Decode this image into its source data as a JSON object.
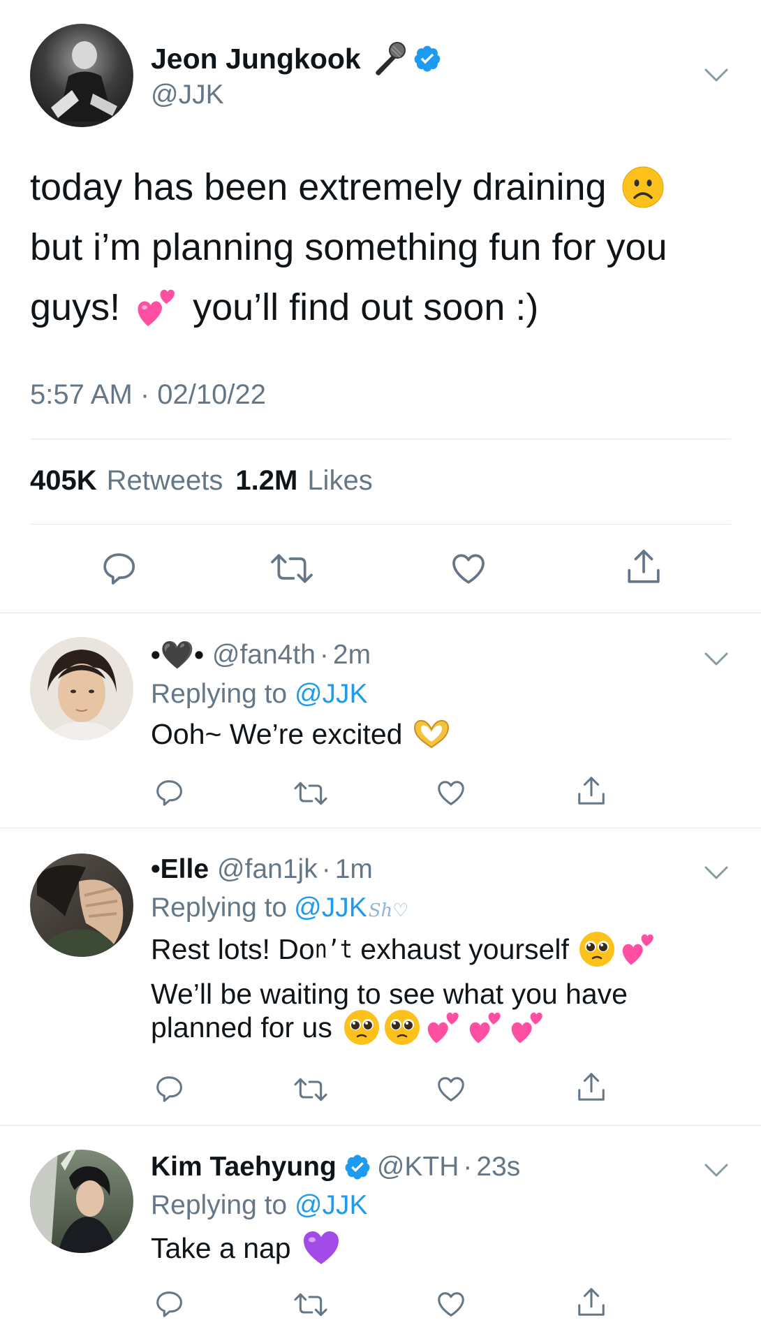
{
  "main_tweet": {
    "name": "Jeon Jungkook",
    "name_emoji": "🎤",
    "handle": "@JJK",
    "text_line1": "today has been extremely draining",
    "text_line2": "but i’m planning something fun for you",
    "text_line3a": "guys!",
    "text_line3b": "you’ll find out soon :)",
    "timestamp": "5:57 AM · 02/10/22",
    "retweets_count": "405K",
    "retweets_label": "Retweets",
    "likes_count": "1.2M",
    "likes_label": "Likes"
  },
  "replies": [
    {
      "name": "•🖤•",
      "handle": "@fan4th",
      "time": "2m",
      "replying_label": "Replying to",
      "replying_to": "@JJK",
      "text": "Ooh~ We’re excited"
    },
    {
      "name": "•Elle",
      "handle": "@fan1jk",
      "time": "1m",
      "replying_label": "Replying to",
      "replying_to": "@JJK",
      "scribble": "Sh♡",
      "text_line1a": "Rest lots! Do",
      "text_line1b": "n’t",
      "text_line1c": " exhaust yourself",
      "text_line2": "We’ll be waiting to see what you have",
      "text_line3": "planned for us"
    },
    {
      "name": "Kim Taehyung",
      "handle": "@KTH",
      "time": "23s",
      "replying_label": "Replying to",
      "replying_to": "@JJK",
      "text": "Take a nap"
    }
  ],
  "colors": {
    "verified_blue": "#1d9bf0",
    "secondary_text": "#657786",
    "divider": "#e1e8ed",
    "pink_heart": "#ff4fa3",
    "purple_heart": "#a34be8"
  }
}
